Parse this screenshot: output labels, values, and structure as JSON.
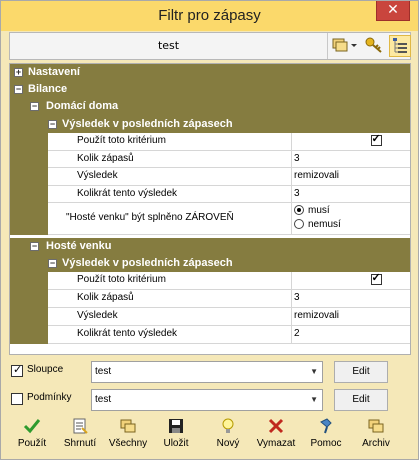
{
  "window": {
    "title": "Filtr pro zápasy",
    "close_glyph": "✕"
  },
  "filter": {
    "name": "test",
    "toolbar_icons": [
      "filters-dropdown-icon",
      "key-icon",
      "tree-view-icon"
    ]
  },
  "tree": {
    "nastaveni": "Nastavení",
    "bilance": "Bilance",
    "domaci": "Domácí doma",
    "vysledek_posl_1": "Výsledek v posledních zápasech",
    "props1": {
      "pouzit": "Použít toto kritérium",
      "kolik": "Kolik zápasů",
      "kolik_val": "3",
      "vysledek": "Výsledek",
      "vysledek_val": "remizovali",
      "kolikrat": "Kolikrát tento výsledek",
      "kolikrat_val": "3",
      "hoste_cond": "\"Hosté venku\" být splněno ZÁROVEŇ",
      "musi": "musí",
      "nemusi": "nemusí"
    },
    "hoste": "Hosté venku",
    "vysledek_posl_2": "Výsledek v posledních zápasech",
    "props2": {
      "pouzit": "Použít toto kritérium",
      "kolik": "Kolik zápasů",
      "kolik_val": "3",
      "vysledek": "Výsledek",
      "vysledek_val": "remizovali",
      "kolikrat": "Kolikrát tento výsledek",
      "kolikrat_val": "2"
    },
    "expand_plus": "+",
    "expand_minus": "−",
    "checkmark": "✓"
  },
  "sloupce": {
    "label": "Sloupce",
    "value": "test",
    "edit": "Edit",
    "checked": true
  },
  "podminky": {
    "label": "Podmínky",
    "value": "test",
    "edit": "Edit",
    "checked": false
  },
  "buttons": {
    "pouzit": "Použít",
    "shrnuti": "Shrnutí",
    "vsechny": "Všechny",
    "ulozit": "Uložit",
    "novy": "Nový",
    "vymazat": "Vymazat",
    "pomoc": "Pomoc",
    "archiv": "Archiv"
  },
  "colors": {
    "title_bar": "#fbd96b",
    "window_bg": "#f5e8b8",
    "category_row": "#857c40",
    "close_button": "#c9453d",
    "apply_check": "#2e9b2e",
    "delete_x": "#c0281e"
  }
}
